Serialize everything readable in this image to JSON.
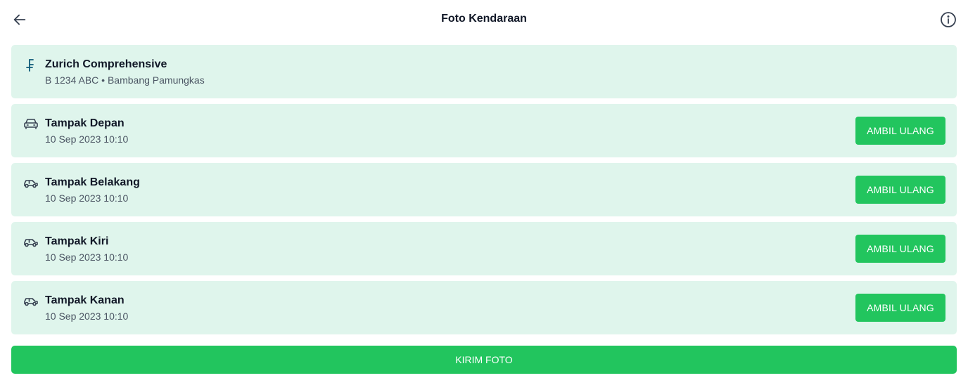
{
  "header": {
    "title": "Foto Kendaraan",
    "back_icon": "arrow-left-icon",
    "info_icon": "info-circle-icon"
  },
  "policy": {
    "icon": "franc-currency-icon",
    "title": "Zurich Comprehensive",
    "subtitle": "B 1234 ABC • Bambang Pamungkas"
  },
  "photos": [
    {
      "icon": "car-front-icon",
      "title": "Tampak Depan",
      "timestamp": "10 Sep 2023 10:10",
      "action_label": "AMBIL ULANG"
    },
    {
      "icon": "car-side-icon",
      "title": "Tampak Belakang",
      "timestamp": "10 Sep 2023 10:10",
      "action_label": "AMBIL ULANG"
    },
    {
      "icon": "car-side-icon",
      "title": "Tampak Kiri",
      "timestamp": "10 Sep 2023 10:10",
      "action_label": "AMBIL ULANG"
    },
    {
      "icon": "car-side-icon",
      "title": "Tampak Kanan",
      "timestamp": "10 Sep 2023 10:10",
      "action_label": "AMBIL ULANG"
    }
  ],
  "submit_label": "KIRIM FOTO",
  "colors": {
    "card_background": "#dff5ec",
    "accent_green": "#22c55e",
    "policy_icon": "#0e5a78",
    "icon_gray": "#374151"
  }
}
